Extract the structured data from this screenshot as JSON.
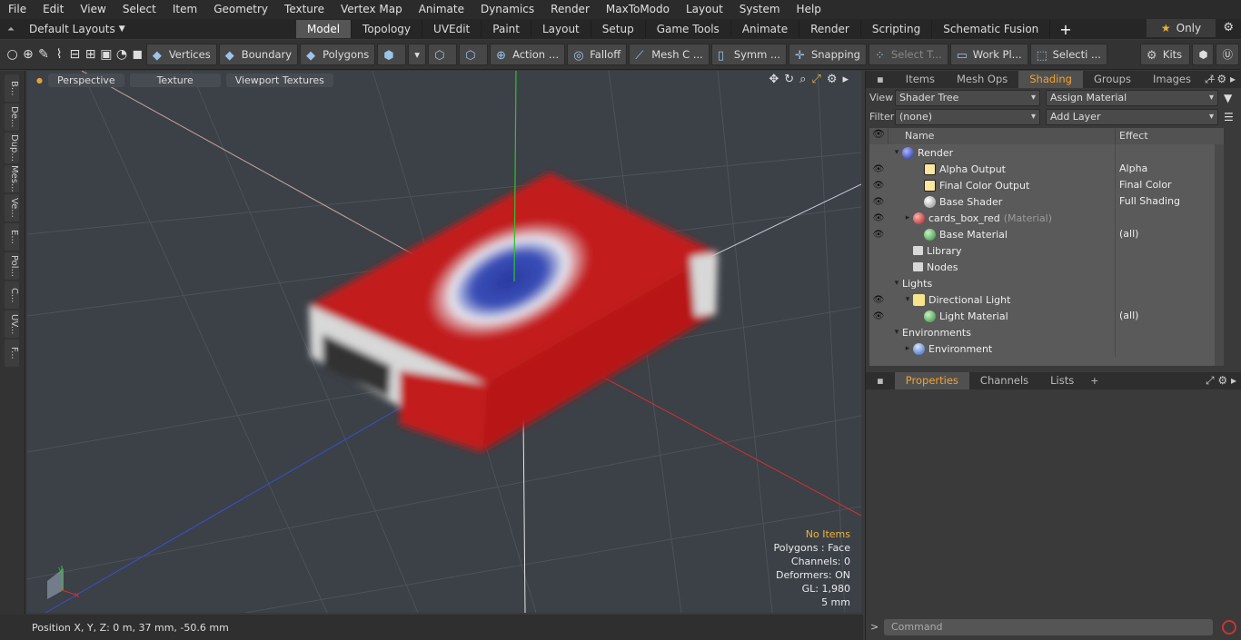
{
  "menu": [
    "File",
    "Edit",
    "View",
    "Select",
    "Item",
    "Geometry",
    "Texture",
    "Vertex Map",
    "Animate",
    "Dynamics",
    "Render",
    "MaxToModo",
    "Layout",
    "System",
    "Help"
  ],
  "layouts": {
    "label": "Default Layouts"
  },
  "mode_tabs": [
    "Model",
    "Topology",
    "UVEdit",
    "Paint",
    "Layout",
    "Setup",
    "Game Tools",
    "Animate",
    "Render",
    "Scripting",
    "Schematic Fusion"
  ],
  "active_mode_tab": "Model",
  "only_label": "Only",
  "toolbar": {
    "vertices": "Vertices",
    "boundary": "Boundary",
    "polygons": "Polygons",
    "action": "Action",
    "falloff": "Falloff",
    "mesh": "Mesh C ...",
    "symm": "Symm ...",
    "snapping": "Snapping",
    "select_t": "Select T...",
    "work_pl": "Work Pl...",
    "selecti": "Selecti ...",
    "kits": "Kits"
  },
  "left_tabs": [
    "B...",
    "De...",
    "Dup...",
    "Mes...",
    "Ve...",
    "E...",
    "Pol...",
    "C...",
    "UV...",
    "F..."
  ],
  "viewport": {
    "tabs": [
      "Perspective",
      "Texture",
      "Viewport Textures"
    ],
    "stats": [
      "No Items",
      "Polygons : Face",
      "Channels: 0",
      "Deformers: ON",
      "GL: 1,980",
      "5 mm"
    ],
    "axis_colors": {
      "x": "#d23030",
      "y": "#30c030",
      "z": "#3a4ed0"
    },
    "object_colors": {
      "main": "#c21d1d",
      "emblem": "#2a3aa0",
      "side": "#d8d8d8"
    }
  },
  "status": {
    "position": "Position X, Y, Z:   0 m, 37 mm, -50.6 mm"
  },
  "panel_tabs": [
    "Items",
    "Mesh Ops",
    "Shading",
    "Groups",
    "Images"
  ],
  "active_panel_tab": "Shading",
  "shading": {
    "view_label": "View",
    "view_value": "Shader Tree",
    "assign": "Assign Material",
    "filter_label": "Filter",
    "filter_value": "(none)",
    "add_layer": "Add Layer",
    "col_name": "Name",
    "col_effect": "Effect",
    "rows": [
      {
        "name": "Render",
        "effect": "",
        "indent": 0,
        "eye": false,
        "icon": "sph-blue",
        "tw": "▾"
      },
      {
        "name": "Alpha Output",
        "effect": "Alpha",
        "indent": 2,
        "eye": true,
        "icon": "sq-out",
        "tw": "",
        "dd": true
      },
      {
        "name": "Final Color Output",
        "effect": "Final Color",
        "indent": 2,
        "eye": true,
        "icon": "sq-out",
        "tw": "",
        "dd": true
      },
      {
        "name": "Base Shader",
        "effect": "Full Shading",
        "indent": 2,
        "eye": true,
        "icon": "sph-white",
        "tw": "",
        "dd": true
      },
      {
        "name": "cards_box_red",
        "tag": "(Material)",
        "effect": "",
        "indent": 1,
        "eye": true,
        "icon": "sph-red",
        "tw": "▸",
        "dd": true
      },
      {
        "name": "Base Material",
        "effect": "(all)",
        "indent": 2,
        "eye": true,
        "icon": "sph-green",
        "tw": "",
        "dd": true
      },
      {
        "name": "Library",
        "effect": "",
        "indent": 1,
        "eye": false,
        "icon": "folder",
        "tw": ""
      },
      {
        "name": "Nodes",
        "effect": "",
        "indent": 1,
        "eye": false,
        "icon": "folder",
        "tw": ""
      },
      {
        "name": "Lights",
        "effect": "",
        "indent": 0,
        "eye": false,
        "icon": "",
        "tw": "▾"
      },
      {
        "name": "Directional Light",
        "effect": "",
        "indent": 1,
        "eye": true,
        "icon": "light",
        "tw": "▾"
      },
      {
        "name": "Light Material",
        "effect": "(all)",
        "indent": 2,
        "eye": true,
        "icon": "sph-green",
        "tw": "",
        "dd": true
      },
      {
        "name": "Environments",
        "effect": "",
        "indent": 0,
        "eye": false,
        "icon": "",
        "tw": "▾"
      },
      {
        "name": "Environment",
        "effect": "",
        "indent": 1,
        "eye": false,
        "icon": "env",
        "tw": "▸"
      }
    ]
  },
  "lower_tabs": [
    "Properties",
    "Channels",
    "Lists"
  ],
  "active_lower_tab": "Properties",
  "command": {
    "placeholder": "Command",
    "prompt": ">"
  }
}
